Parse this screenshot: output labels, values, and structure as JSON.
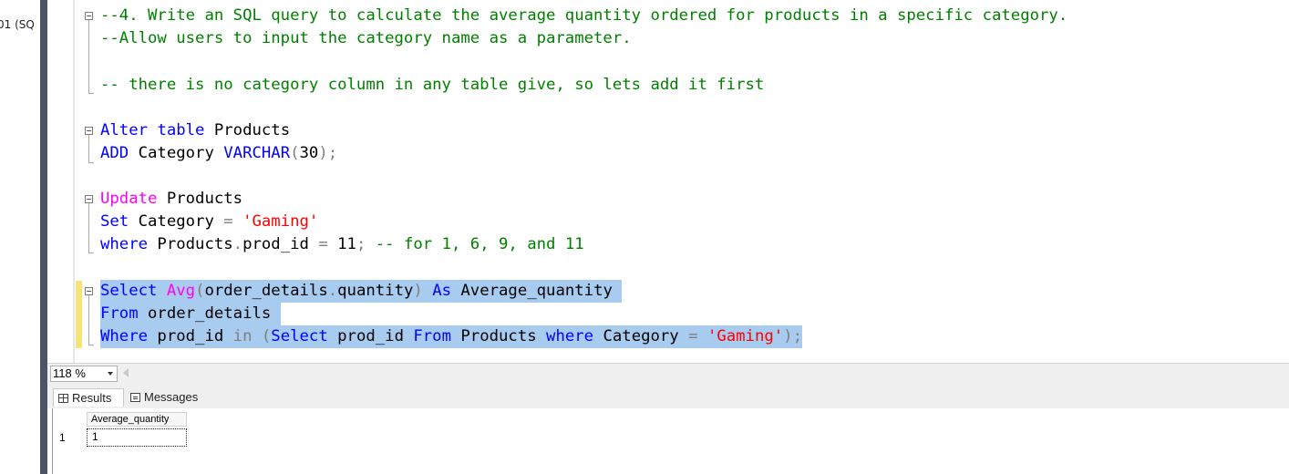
{
  "left_tab": "01 (SQ",
  "editor": {
    "lines": [
      {
        "id": "l1",
        "tokens": [
          {
            "t": "--4. Write an SQL query to calculate the average quantity ordered for products in a specific category.",
            "c": "c"
          }
        ]
      },
      {
        "id": "l2",
        "tokens": [
          {
            "t": "--Allow users to input the category name as a parameter.",
            "c": "c"
          }
        ]
      },
      {
        "id": "l3",
        "tokens": [
          {
            "t": "-- there is no category column in any table give, so lets add it first",
            "c": "c"
          }
        ]
      },
      {
        "id": "l4",
        "tokens": [
          {
            "t": "Alter",
            "c": "k"
          },
          {
            "t": " ",
            "c": ""
          },
          {
            "t": "table",
            "c": "k"
          },
          {
            "t": " Products",
            "c": ""
          }
        ]
      },
      {
        "id": "l5",
        "tokens": [
          {
            "t": "ADD",
            "c": "k"
          },
          {
            "t": " Category ",
            "c": ""
          },
          {
            "t": "VARCHAR",
            "c": "k"
          },
          {
            "t": "(",
            "c": "g"
          },
          {
            "t": "30",
            "c": ""
          },
          {
            "t": ");",
            "c": "g"
          }
        ]
      },
      {
        "id": "l6",
        "tokens": [
          {
            "t": "Update",
            "c": "f"
          },
          {
            "t": " Products",
            "c": ""
          }
        ]
      },
      {
        "id": "l7",
        "tokens": [
          {
            "t": "Set",
            "c": "k"
          },
          {
            "t": " Category ",
            "c": ""
          },
          {
            "t": "=",
            "c": "g"
          },
          {
            "t": " ",
            "c": ""
          },
          {
            "t": "'Gaming'",
            "c": "s"
          }
        ]
      },
      {
        "id": "l8",
        "tokens": [
          {
            "t": "where",
            "c": "k"
          },
          {
            "t": " Products",
            "c": ""
          },
          {
            "t": ".",
            "c": "g"
          },
          {
            "t": "prod_id ",
            "c": ""
          },
          {
            "t": "=",
            "c": "g"
          },
          {
            "t": " 11",
            "c": ""
          },
          {
            "t": ";",
            "c": "g"
          },
          {
            "t": " -- for 1, 6, 9, and 11",
            "c": "c"
          }
        ]
      },
      {
        "id": "l9",
        "tokens": [
          {
            "t": "Select",
            "c": "k"
          },
          {
            "t": " ",
            "c": ""
          },
          {
            "t": "Avg",
            "c": "f"
          },
          {
            "t": "(",
            "c": "g"
          },
          {
            "t": "order_details",
            "c": ""
          },
          {
            "t": ".",
            "c": "g"
          },
          {
            "t": "quantity",
            "c": ""
          },
          {
            "t": ")",
            "c": "g"
          },
          {
            "t": " ",
            "c": ""
          },
          {
            "t": "As",
            "c": "k"
          },
          {
            "t": " Average_quantity ",
            "c": ""
          }
        ]
      },
      {
        "id": "l10",
        "tokens": [
          {
            "t": "From",
            "c": "k"
          },
          {
            "t": " order_details ",
            "c": ""
          }
        ]
      },
      {
        "id": "l11",
        "tokens": [
          {
            "t": "Where",
            "c": "k"
          },
          {
            "t": " prod_id ",
            "c": ""
          },
          {
            "t": "in",
            "c": "g"
          },
          {
            "t": " ",
            "c": ""
          },
          {
            "t": "(",
            "c": "g"
          },
          {
            "t": "Select",
            "c": "k"
          },
          {
            "t": " prod_id ",
            "c": ""
          },
          {
            "t": "From",
            "c": "k"
          },
          {
            "t": " Products ",
            "c": ""
          },
          {
            "t": "where",
            "c": "k"
          },
          {
            "t": " Category ",
            "c": ""
          },
          {
            "t": "=",
            "c": "g"
          },
          {
            "t": " ",
            "c": ""
          },
          {
            "t": "'Gaming'",
            "c": "s"
          },
          {
            "t": ");",
            "c": "g"
          }
        ]
      }
    ]
  },
  "status": {
    "zoom": "118 %"
  },
  "results_tabs": {
    "results": "Results",
    "messages": "Messages"
  },
  "grid": {
    "columns": [
      "Average_quantity"
    ],
    "rows": [
      {
        "num": "1",
        "values": [
          "1"
        ]
      }
    ]
  }
}
